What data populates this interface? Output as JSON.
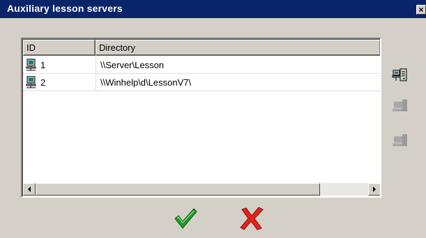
{
  "window": {
    "title": "Auxiliary lesson servers",
    "close_glyph": "×"
  },
  "table": {
    "columns": [
      "ID",
      "Directory"
    ],
    "rows": [
      {
        "id": "1",
        "directory": "\\\\Server\\Lesson",
        "icon": "server-computer-icon"
      },
      {
        "id": "2",
        "directory": "\\\\Winhelp\\d\\LessonV7\\",
        "icon": "server-computer-icon"
      }
    ]
  },
  "side_buttons": [
    {
      "name": "add-server-button",
      "icon": "add-server-icon",
      "enabled": true
    },
    {
      "name": "edit-server-button",
      "icon": "edit-server-icon",
      "enabled": false
    },
    {
      "name": "remove-server-button",
      "icon": "remove-server-icon",
      "enabled": false
    }
  ],
  "footer": {
    "ok_icon": "checkmark-icon",
    "cancel_icon": "red-x-icon"
  },
  "colors": {
    "titlebar": "#0a246a",
    "dialog": "#d4d0c8",
    "ok": "#1f9a2a",
    "cancel": "#e0241c"
  }
}
